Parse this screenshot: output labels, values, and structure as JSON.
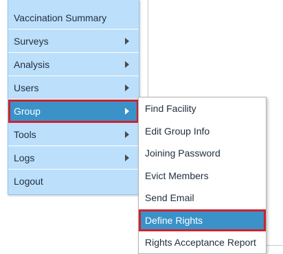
{
  "main_menu": {
    "items": [
      {
        "label": "Vaccination Summary",
        "has_submenu": false
      },
      {
        "label": "Surveys",
        "has_submenu": true
      },
      {
        "label": "Analysis",
        "has_submenu": true
      },
      {
        "label": "Users",
        "has_submenu": true
      },
      {
        "label": "Group",
        "has_submenu": true,
        "active": true
      },
      {
        "label": "Tools",
        "has_submenu": true
      },
      {
        "label": "Logs",
        "has_submenu": true
      },
      {
        "label": "Logout",
        "has_submenu": false
      }
    ]
  },
  "group_submenu": {
    "items": [
      {
        "label": "Find Facility"
      },
      {
        "label": "Edit Group Info"
      },
      {
        "label": "Joining Password"
      },
      {
        "label": "Evict Members"
      },
      {
        "label": "Send Email"
      },
      {
        "label": "Define Rights",
        "active": true
      },
      {
        "label": "Rights Acceptance Report"
      }
    ]
  },
  "colors": {
    "menu_bg": "#bcdffb",
    "active_bg": "#3a92c9",
    "highlight_border": "#d0212b"
  }
}
